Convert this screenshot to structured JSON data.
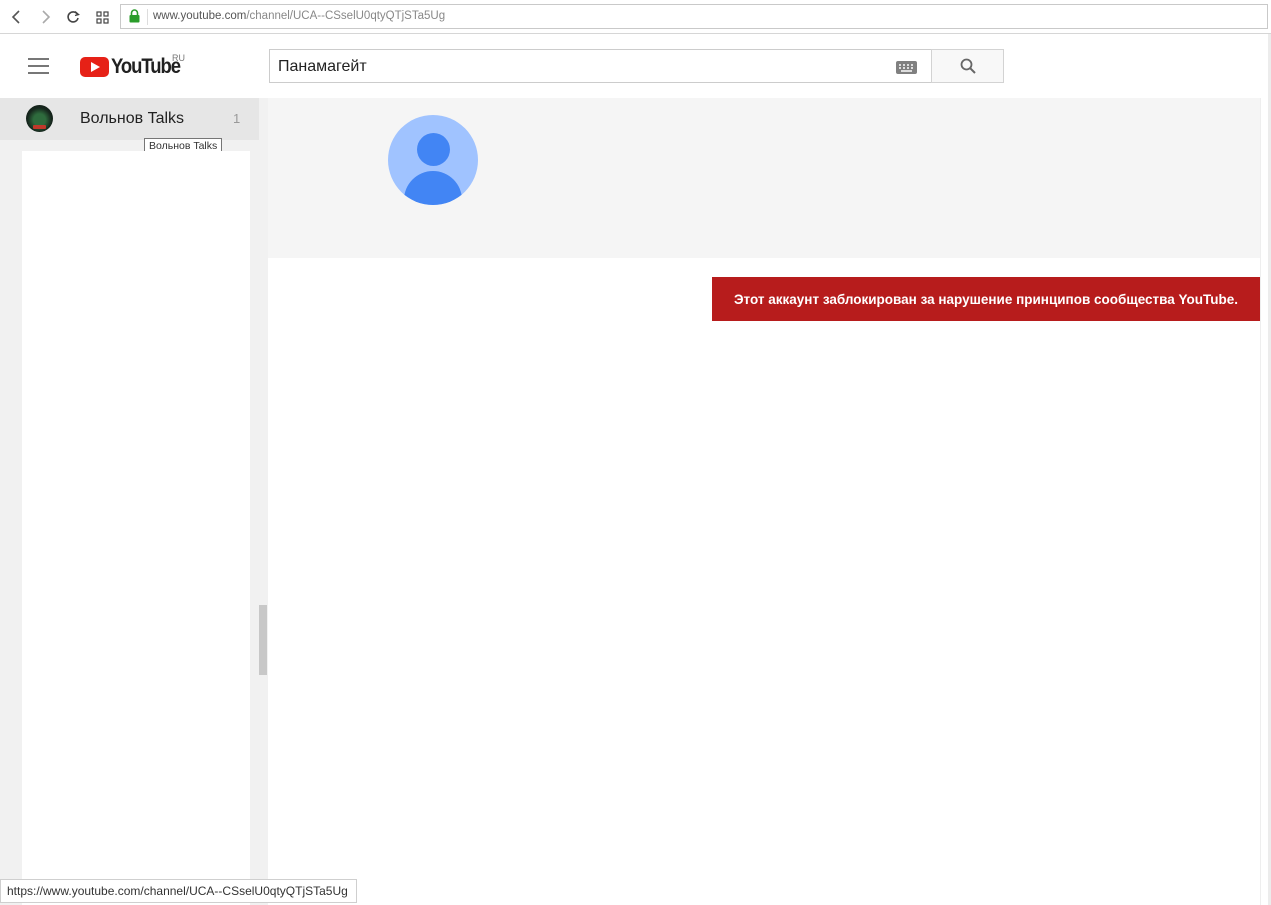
{
  "browser": {
    "url_domain": "www.youtube.com",
    "url_path": "/channel/UCA--CSselU0qtyQTjSTa5Ug",
    "status_url": "https://www.youtube.com/channel/UCA--CSselU0qtyQTjSTa5Ug"
  },
  "masthead": {
    "logo_text": "YouTube",
    "region": "RU",
    "search_value": "Панамагейт"
  },
  "guide": {
    "items": [
      {
        "label": "Вольнов Talks",
        "count": "1",
        "tooltip": "Вольнов Talks"
      }
    ]
  },
  "alert": {
    "message": "Этот аккаунт заблокирован за нарушение принципов сообщества YouTube."
  },
  "colors": {
    "brand_red": "#e62117",
    "alert_bg": "#b71c1c",
    "avatar_bg": "#a0c3ff",
    "avatar_fg": "#4285f4"
  }
}
